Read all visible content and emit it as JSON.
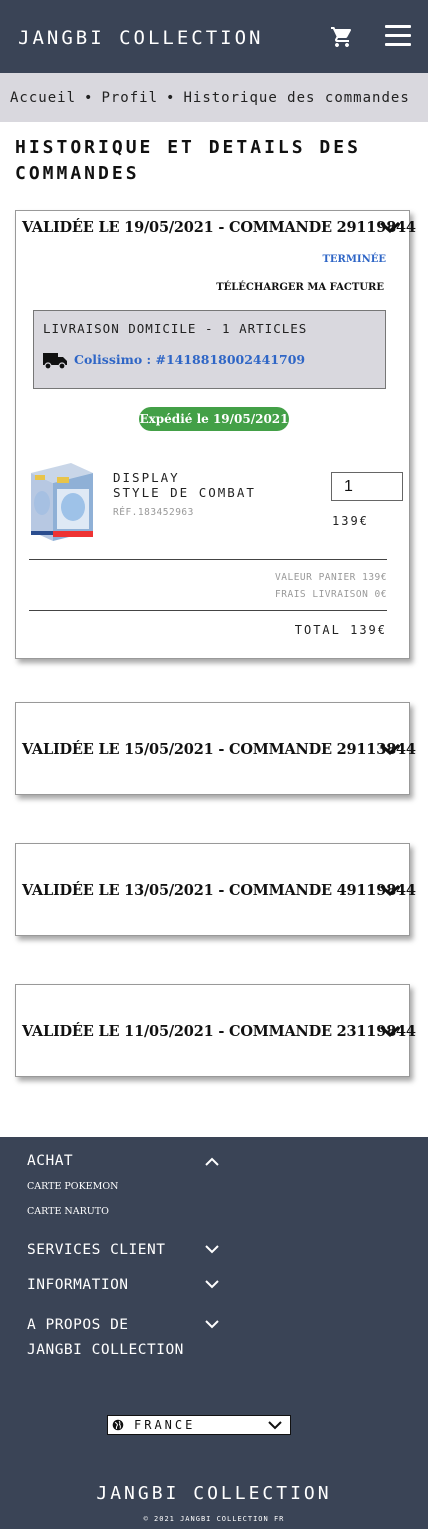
{
  "header": {
    "brand": "JANGBI COLLECTION",
    "cart_icon": "shopping-cart-icon",
    "menu_icon": "hamburger-menu-icon"
  },
  "breadcrumb": {
    "items": [
      "Accueil",
      "Profil",
      "Historique des commandes"
    ],
    "separator": "•"
  },
  "page": {
    "title": "HISTORIQUE ET DETAILS DES COMMANDES"
  },
  "orders": [
    {
      "heading": "VALIDÉE LE 19/05/2021 - COMMANDE 29119844",
      "expanded": true,
      "status": "TERMINÉE",
      "invoice_link": "TÉLÉCHARGER MA FACTURE",
      "delivery": {
        "title": "LIVRAISON DOMICILE - 1 ARTICLES",
        "tracking": "Colissimo : #1418818002441709"
      },
      "shipped_badge": "Expédié le 19/05/2021",
      "product": {
        "name_line1": "DISPLAY",
        "name_line2": "STYLE DE COMBAT",
        "ref": "RÉF.183452963",
        "qty": "1",
        "price": "139€"
      },
      "summary": {
        "cart_value": "VALEUR PANIER 139€",
        "shipping": "FRAIS LIVRAISON 0€",
        "total": "TOTAL 139€"
      }
    },
    {
      "heading": "VALIDÉE LE 15/05/2021 - COMMANDE 29113844",
      "expanded": false
    },
    {
      "heading": "VALIDÉE LE 13/05/2021 - COMMANDE 49119844",
      "expanded": false
    },
    {
      "heading": "VALIDÉE LE 11/05/2021 - COMMANDE 23119844",
      "expanded": false
    }
  ],
  "footer": {
    "sections": [
      {
        "label": "ACHAT",
        "expanded": true,
        "items": [
          "CARTE POKEMON",
          "CARTE NARUTO"
        ]
      },
      {
        "label": "SERVICES CLIENT",
        "expanded": false
      },
      {
        "label": "INFORMATION",
        "expanded": false
      },
      {
        "label_line1": "A PROPOS DE",
        "label_line2": "JANGBI COLLECTION",
        "expanded": false
      }
    ],
    "country": "FRANCE",
    "brand": "JANGBI COLLECTION",
    "copyright": "© 2021 JANGBI COLLECTION FR"
  },
  "colors": {
    "header_bg": "#3a4456",
    "breadcrumb_bg": "#d9d8de",
    "link_blue": "#2f66c6",
    "badge_green": "#43a047"
  }
}
